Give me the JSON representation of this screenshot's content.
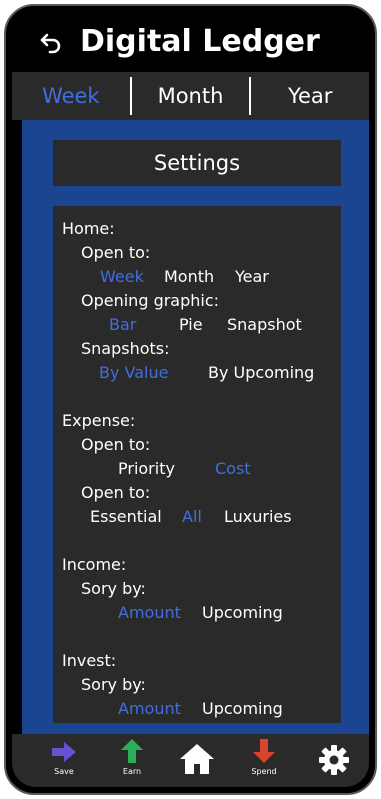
{
  "header": {
    "title": "Digital Ledger",
    "back_icon": "back-arrow-icon"
  },
  "tabs": [
    {
      "label": "Week",
      "active": true
    },
    {
      "label": "Month",
      "active": false
    },
    {
      "label": "Year",
      "active": false
    }
  ],
  "settings": {
    "title": "Settings"
  },
  "home": {
    "heading": "Home:",
    "open_to_label": "Open to:",
    "open_to_options": [
      "Week",
      "Month",
      "Year"
    ],
    "open_to_selected": "Week",
    "graphic_label": "Opening graphic:",
    "graphic_options": [
      "Bar",
      "Pie",
      "Snapshot"
    ],
    "graphic_selected": "Bar",
    "snapshots_label": "Snapshots:",
    "snapshots_options": [
      "By Value",
      "By Upcoming"
    ],
    "snapshots_selected": "By Value"
  },
  "expense": {
    "heading": "Expense:",
    "open_to_label_1": "Open to:",
    "sort_options": [
      "Priority",
      "Cost"
    ],
    "sort_selected": "Cost",
    "open_to_label_2": "Open to:",
    "filter_options": [
      "Essential",
      "All",
      "Luxuries"
    ],
    "filter_selected": "All"
  },
  "income": {
    "heading": "Income:",
    "sort_label": "Sory by:",
    "sort_options": [
      "Amount",
      "Upcoming"
    ],
    "sort_selected": "Amount"
  },
  "invest": {
    "heading": "Invest:",
    "sort_label": "Sory by:",
    "sort_options": [
      "Amount",
      "Upcoming"
    ],
    "sort_selected": "Amount"
  },
  "bottom_nav": {
    "save": {
      "label": "Save",
      "icon": "arrow-right-icon",
      "color": "#6a4fd6"
    },
    "earn": {
      "label": "Earn",
      "icon": "arrow-up-icon",
      "color": "#2fae5a"
    },
    "home": {
      "label": "",
      "icon": "home-icon",
      "color": "#ffffff"
    },
    "spend": {
      "label": "Spend",
      "icon": "arrow-down-icon",
      "color": "#d8452e"
    },
    "settings": {
      "label": "",
      "icon": "gear-icon",
      "color": "#ffffff"
    }
  },
  "colors": {
    "accent": "#3f6fe0",
    "panel": "#1b4591",
    "card": "#2a2a2a"
  }
}
